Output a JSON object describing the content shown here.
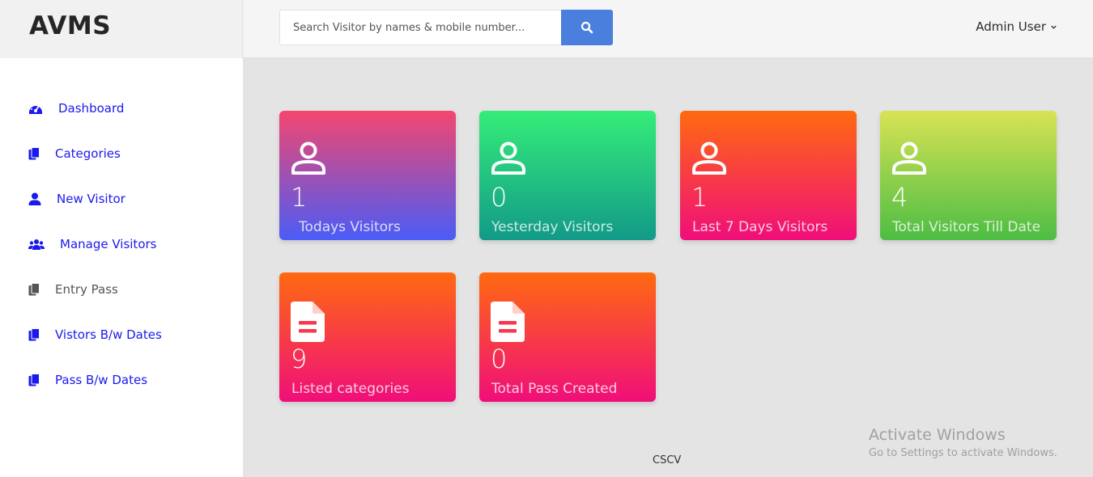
{
  "brand": {
    "name": "AVMS"
  },
  "search": {
    "placeholder": "Search Visitor by names & mobile number...",
    "value": ""
  },
  "header": {
    "user_label": "Admin User"
  },
  "sidebar": {
    "items": [
      {
        "label": "Dashboard",
        "icon": "dashboard-icon"
      },
      {
        "label": "Categories",
        "icon": "copy-icon"
      },
      {
        "label": "New Visitor",
        "icon": "user-icon"
      },
      {
        "label": "Manage Visitors",
        "icon": "users-icon"
      },
      {
        "label": "Entry Pass",
        "icon": "copy-icon"
      },
      {
        "label": "Vistors B/w Dates",
        "icon": "copy-icon"
      },
      {
        "label": "Pass B/w Dates",
        "icon": "copy-icon"
      }
    ]
  },
  "cards": [
    {
      "value": "1",
      "label": "Todays Visitors",
      "icon": "user-icon"
    },
    {
      "value": "0",
      "label": "Yesterday Visitors",
      "icon": "user-icon"
    },
    {
      "value": "1",
      "label": "Last 7 Days Visitors",
      "icon": "user-icon"
    },
    {
      "value": "4",
      "label": "Total Visitors Till Date",
      "icon": "user-icon"
    },
    {
      "value": "9",
      "label": "Listed categories",
      "icon": "file-icon"
    },
    {
      "value": "0",
      "label": "Total Pass Created",
      "icon": "file-icon"
    }
  ],
  "footer": {
    "text": "CSCV"
  },
  "watermark": {
    "title": "Activate Windows",
    "subtitle": "Go to Settings to activate Windows."
  },
  "colors": {
    "accent": "#4a7fdd",
    "nav_link": "#1a1aee",
    "nav_muted": "#555555"
  }
}
